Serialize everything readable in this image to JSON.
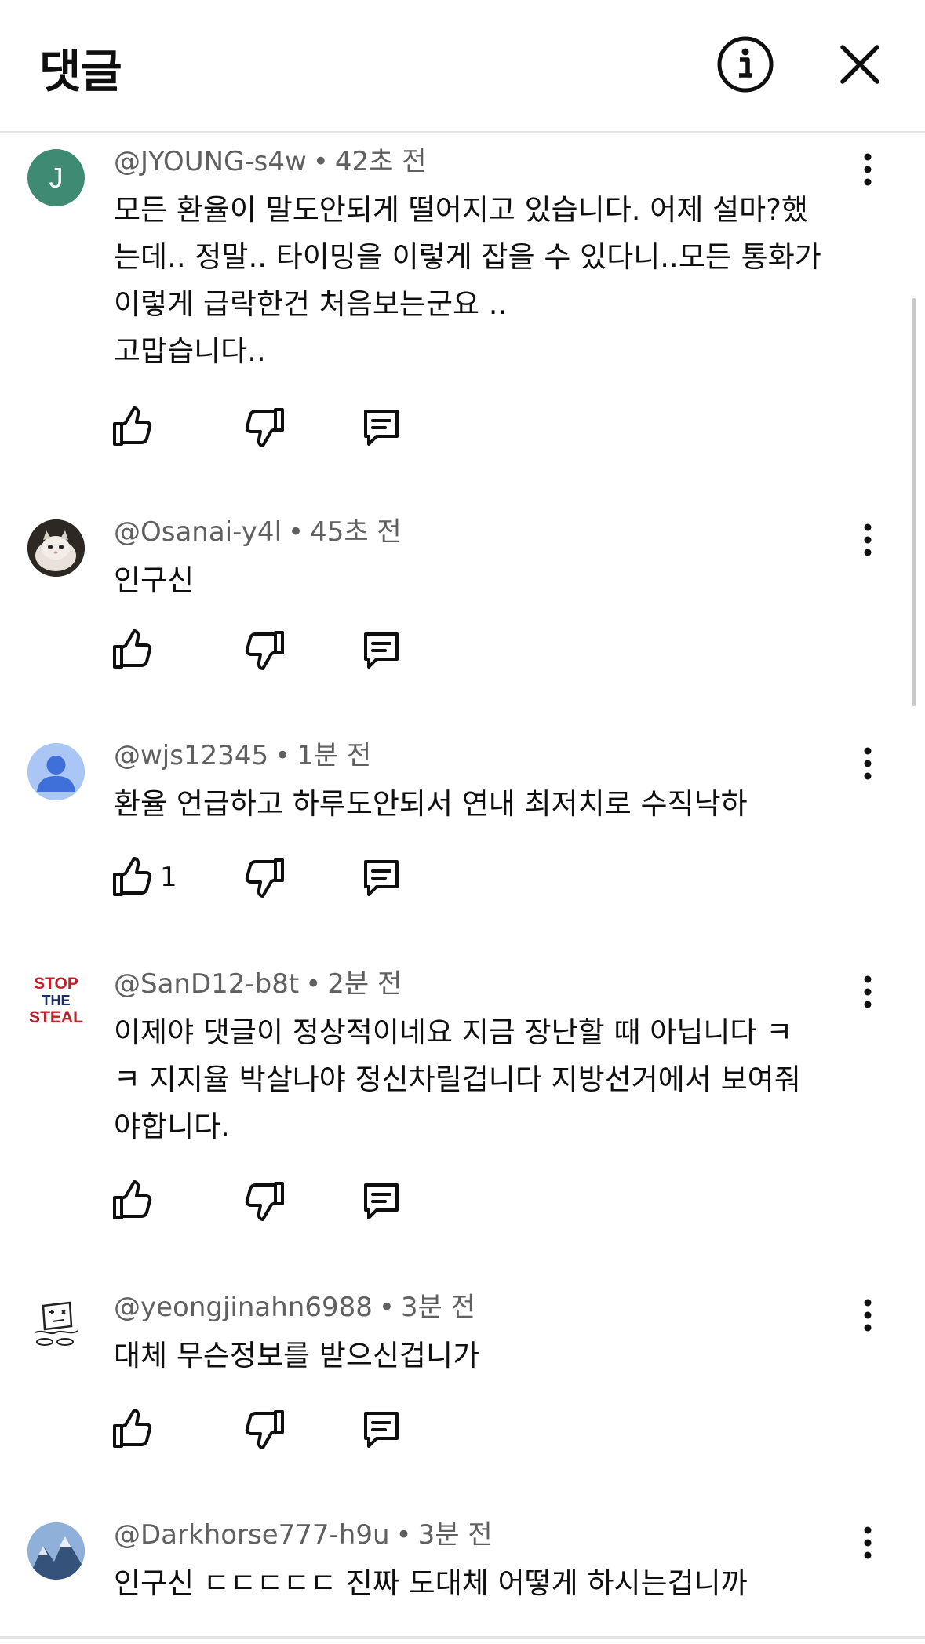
{
  "header": {
    "title": "댓글"
  },
  "comments": [
    {
      "author": "@JYOUNG-s4w",
      "time": "42초 전",
      "text": "모든 환율이 말도안되게 떨어지고 있습니다. 어제 설마?했\n는데.. 정말.. 타이밍을 이렇게 잡을 수 있다니..모든 통화가\n이렇게 급락한건 처음보는군요 ..\n고맙습니다..",
      "avatar_letter": "J",
      "avatar_color": "#3e8a73",
      "likes": ""
    },
    {
      "author": "@Osanai-y4l",
      "time": "45초 전",
      "text": "인구신",
      "avatar_letter": "",
      "likes": ""
    },
    {
      "author": "@wjs12345",
      "time": "1분 전",
      "text": "환율 언급하고 하루도안되서 연내 최저치로 수직낙하",
      "avatar_letter": "",
      "avatar_color": "#a9c6f5",
      "likes": "1"
    },
    {
      "author": "@SanD12-b8t",
      "time": "2분 전",
      "text": "이제야 댓글이 정상적이네요 지금 장난할 때 아닙니다 ㅋ\nㅋ 지지율 박살나야 정신차릴겁니다 지방선거에서 보여줘\n야합니다.",
      "avatar_letter": "",
      "avatar_text": [
        "STOP",
        "THE",
        "STEAL"
      ],
      "likes": ""
    },
    {
      "author": "@yeongjinahn6988",
      "time": "3분 전",
      "text": "대체 무슨정보를 받으신겁니가",
      "avatar_letter": "",
      "likes": ""
    },
    {
      "author": "@Darkhorse777-h9u",
      "time": "3분 전",
      "text": "인구신 ㄷㄷㄷㄷㄷ 진짜 도대체 어떻게 하시는겁니까",
      "avatar_letter": "",
      "likes": ""
    }
  ],
  "icons": {
    "info": "info-icon",
    "close": "close-icon",
    "more": "more-vert-icon",
    "like": "thumb-up-icon",
    "dislike": "thumb-down-icon",
    "reply": "reply-icon"
  },
  "colors": {
    "text": "#0f0f0f",
    "meta": "#606060",
    "divider": "#e5e5e5"
  }
}
